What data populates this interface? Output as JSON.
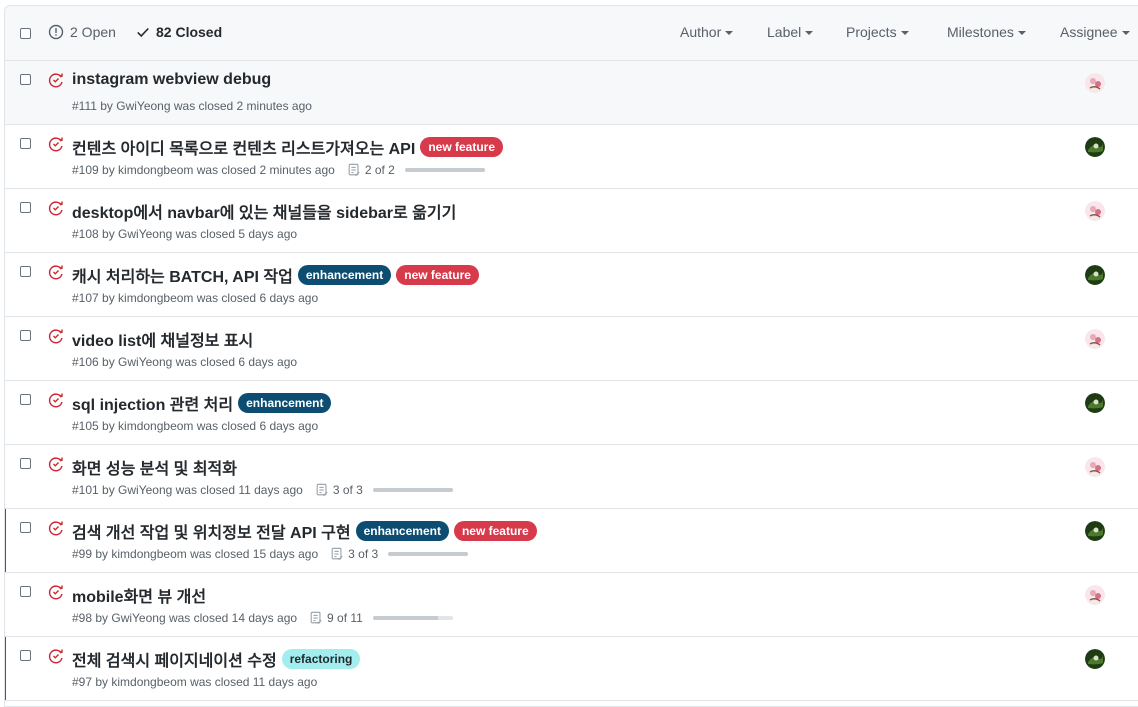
{
  "header": {
    "open_label": "2 Open",
    "closed_label": "82 Closed",
    "filters": [
      "Author",
      "Label",
      "Projects",
      "Milestones",
      "Assignee"
    ]
  },
  "colors": {
    "closed_icon": "#cb2431",
    "link_accent": "#0366d6"
  },
  "issues": [
    {
      "title": "instagram webview debug",
      "meta": "#111 by GwiYeong was closed 2 minutes ago",
      "labels": [],
      "progress": null,
      "avatar": "gwiyeong"
    },
    {
      "title": "컨텐츠 아이디 목록으로 컨텐츠 리스트가져오는 API",
      "meta": "#109 by kimdongbeom was closed 2 minutes ago",
      "labels": [
        {
          "name": "new feature",
          "bg": "#d73a4a",
          "fg": "#ffffff"
        }
      ],
      "progress": {
        "text": "2 of 2",
        "fraction": 1.0
      },
      "avatar": "kimdongbeom"
    },
    {
      "title": "desktop에서 navbar에 있는 채널들을 sidebar로 옮기기",
      "meta": "#108 by GwiYeong was closed 5 days ago",
      "labels": [],
      "progress": null,
      "avatar": "gwiyeong"
    },
    {
      "title": "캐시 처리하는 BATCH, API 작업",
      "meta": "#107 by kimdongbeom was closed 6 days ago",
      "labels": [
        {
          "name": "enhancement",
          "bg": "#0e4d72",
          "fg": "#ffffff"
        },
        {
          "name": "new feature",
          "bg": "#d73a4a",
          "fg": "#ffffff"
        }
      ],
      "progress": null,
      "avatar": "kimdongbeom"
    },
    {
      "title": "video list에 채널정보 표시",
      "meta": "#106 by GwiYeong was closed 6 days ago",
      "labels": [],
      "progress": null,
      "avatar": "gwiyeong"
    },
    {
      "title": "sql injection 관련 처리",
      "meta": "#105 by kimdongbeom was closed 6 days ago",
      "labels": [
        {
          "name": "enhancement",
          "bg": "#0e4d72",
          "fg": "#ffffff"
        }
      ],
      "progress": null,
      "avatar": "kimdongbeom"
    },
    {
      "title": "화면 성능 분석 및 최적화",
      "meta": "#101 by GwiYeong was closed 11 days ago",
      "labels": [],
      "progress": {
        "text": "3 of 3",
        "fraction": 1.0
      },
      "avatar": "gwiyeong"
    },
    {
      "title": "검색 개선 작업 및 위치정보 전달 API 구현",
      "meta": "#99 by kimdongbeom was closed 15 days ago",
      "labels": [
        {
          "name": "enhancement",
          "bg": "#0e4d72",
          "fg": "#ffffff"
        },
        {
          "name": "new feature",
          "bg": "#d73a4a",
          "fg": "#ffffff"
        }
      ],
      "progress": {
        "text": "3 of 3",
        "fraction": 1.0
      },
      "avatar": "kimdongbeom",
      "accent": true
    },
    {
      "title": "mobile화면 뷰 개선",
      "meta": "#98 by GwiYeong was closed 14 days ago",
      "labels": [],
      "progress": {
        "text": "9 of 11",
        "fraction": 0.82
      },
      "avatar": "gwiyeong"
    },
    {
      "title": "전체 검색시 페이지네이션 수정",
      "meta": "#97 by kimdongbeom was closed 11 days ago",
      "labels": [
        {
          "name": "refactoring",
          "bg": "#a2eeef",
          "fg": "#24292e"
        }
      ],
      "progress": null,
      "avatar": "kimdongbeom",
      "accent": true
    }
  ]
}
